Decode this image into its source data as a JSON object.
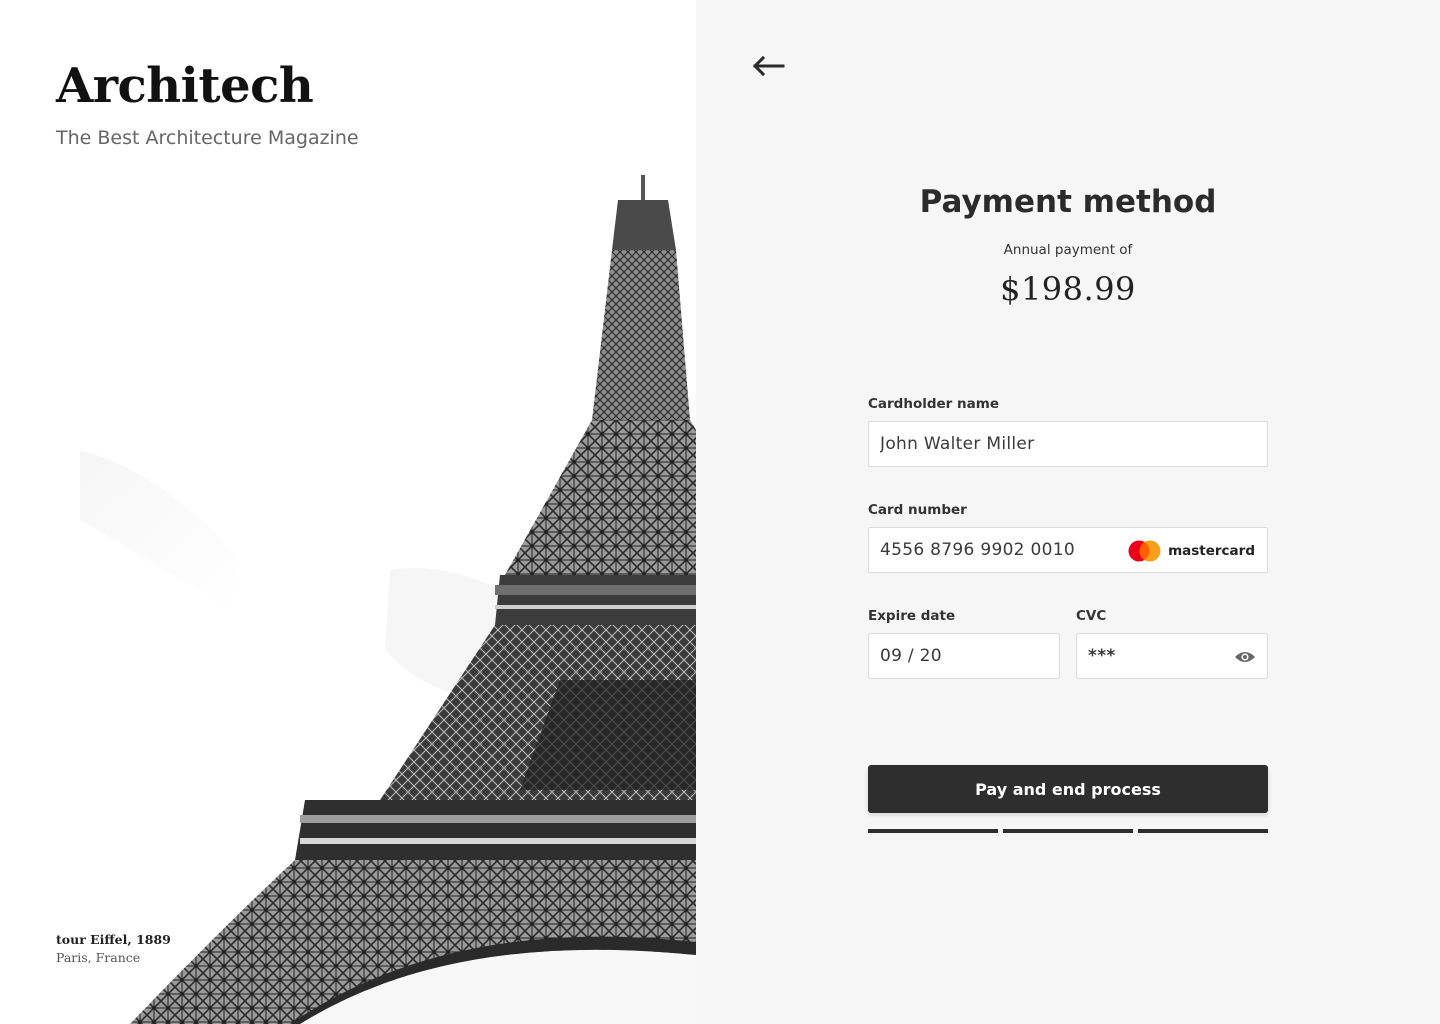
{
  "brand": {
    "title": "Architech",
    "subtitle": "The Best Architecture Magazine"
  },
  "photo": {
    "caption_title": "tour Eiffel, 1889",
    "caption_location": "Paris, France",
    "icon": "eiffel-tower-photo"
  },
  "nav": {
    "back_icon": "arrow-left-icon"
  },
  "payment": {
    "heading": "Payment method",
    "annual_label": "Annual payment of",
    "price": "$198.99"
  },
  "form": {
    "cardholder": {
      "label": "Cardholder name",
      "value": "John Walter Miller"
    },
    "card_number": {
      "label": "Card number",
      "value": "4556 8796 9902 0010",
      "brand": "mastercard",
      "brand_colors": [
        "#eb001b",
        "#f79e1b"
      ]
    },
    "expire": {
      "label": "Expire date",
      "value": "09 / 20"
    },
    "cvc": {
      "label": "CVC",
      "value": "***",
      "icon": "eye-icon"
    }
  },
  "actions": {
    "pay_label": "Pay and end process"
  },
  "progress": {
    "steps_total": 3,
    "steps_completed": 3
  },
  "colors": {
    "right_background": "#f6f6f6",
    "button": "#2e2e2e"
  }
}
